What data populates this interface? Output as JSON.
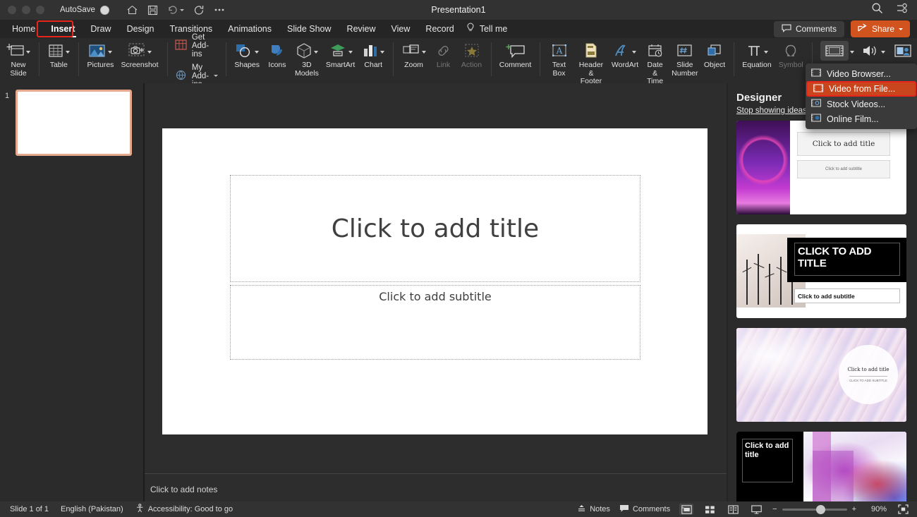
{
  "titlebar": {
    "autosave_label": "AutoSave",
    "document_title": "Presentation1",
    "qat": [
      {
        "name": "home-icon",
        "label": "Home"
      },
      {
        "name": "save-icon",
        "label": "Save"
      },
      {
        "name": "undo-icon",
        "label": "Undo"
      },
      {
        "name": "redo-icon",
        "label": "Redo"
      },
      {
        "name": "more-options-icon",
        "label": "More"
      }
    ],
    "search_icon": "search-icon",
    "ribbon_display_icon": "ribbon-display-options-icon"
  },
  "tabs": [
    {
      "label": "Home",
      "selected": false
    },
    {
      "label": "Insert",
      "selected": true
    },
    {
      "label": "Draw",
      "selected": false
    },
    {
      "label": "Design",
      "selected": false
    },
    {
      "label": "Transitions",
      "selected": false
    },
    {
      "label": "Animations",
      "selected": false
    },
    {
      "label": "Slide Show",
      "selected": false
    },
    {
      "label": "Review",
      "selected": false
    },
    {
      "label": "View",
      "selected": false
    },
    {
      "label": "Record",
      "selected": false
    }
  ],
  "tellme": {
    "label": "Tell me",
    "icon": "lightbulb-icon"
  },
  "header_actions": {
    "comments_label": "Comments",
    "share_label": "Share",
    "share_color": "#d1541f"
  },
  "highlight_color": "#e8251b",
  "ribbon": {
    "groups": [
      {
        "name": "slides",
        "buttons": [
          {
            "label": "New\nSlide",
            "icon": "new-slide-icon",
            "split": true,
            "dim": false
          }
        ]
      },
      {
        "name": "tables",
        "buttons": [
          {
            "label": "Table",
            "icon": "table-icon",
            "split": true,
            "dim": false
          }
        ]
      },
      {
        "name": "images",
        "buttons": [
          {
            "label": "Pictures",
            "icon": "pictures-icon",
            "split": true,
            "dim": false
          },
          {
            "label": "Screenshot",
            "icon": "screenshot-icon",
            "split": true,
            "dim": false
          }
        ]
      },
      {
        "name": "add-ins",
        "items": [
          {
            "label": "Get Add-ins",
            "icon": "get-addins-icon",
            "chevron": false
          },
          {
            "label": "My Add-ins",
            "icon": "my-addins-icon",
            "chevron": true
          }
        ]
      },
      {
        "name": "illustrations",
        "buttons": [
          {
            "label": "Shapes",
            "icon": "shapes-icon",
            "split": true,
            "dim": false
          },
          {
            "label": "Icons",
            "icon": "icons-icon",
            "split": false,
            "dim": false
          },
          {
            "label": "3D\nModels",
            "icon": "3d-models-icon",
            "split": true,
            "dim": false
          },
          {
            "label": "SmartArt",
            "icon": "smartart-icon",
            "split": true,
            "dim": false
          },
          {
            "label": "Chart",
            "icon": "chart-icon",
            "split": true,
            "dim": false
          }
        ]
      },
      {
        "name": "links",
        "buttons": [
          {
            "label": "Zoom",
            "icon": "zoom-icon",
            "split": true,
            "dim": false
          },
          {
            "label": "Link",
            "icon": "link-icon",
            "split": false,
            "dim": true
          },
          {
            "label": "Action",
            "icon": "action-icon",
            "split": false,
            "dim": true
          }
        ]
      },
      {
        "name": "comments",
        "buttons": [
          {
            "label": "Comment",
            "icon": "comment-icon",
            "split": false,
            "dim": false
          }
        ]
      },
      {
        "name": "text",
        "buttons": [
          {
            "label": "Text\nBox",
            "icon": "text-box-icon",
            "split": false,
            "dim": false
          },
          {
            "label": "Header &\nFooter",
            "icon": "header-footer-icon",
            "split": false,
            "dim": false
          },
          {
            "label": "WordArt",
            "icon": "wordart-icon",
            "split": true,
            "dim": false
          },
          {
            "label": "Date &\nTime",
            "icon": "date-time-icon",
            "split": false,
            "dim": false
          },
          {
            "label": "Slide\nNumber",
            "icon": "slide-number-icon",
            "split": false,
            "dim": false
          },
          {
            "label": "Object",
            "icon": "object-icon",
            "split": false,
            "dim": false
          }
        ]
      },
      {
        "name": "symbols",
        "buttons": [
          {
            "label": "Equation",
            "icon": "equation-icon",
            "split": true,
            "dim": false
          },
          {
            "label": "Symbol",
            "icon": "symbol-icon",
            "split": false,
            "dim": true
          }
        ]
      },
      {
        "name": "media",
        "buttons": [
          {
            "label": "",
            "icon": "video-icon",
            "split": true,
            "dim": false,
            "pressed": true
          },
          {
            "label": "",
            "icon": "audio-icon",
            "split": true,
            "dim": false
          },
          {
            "label": "",
            "icon": "cameo-icon",
            "split": false,
            "dim": false
          }
        ]
      }
    ]
  },
  "video_menu": {
    "items": [
      {
        "label": "Video Browser...",
        "icon": "video-browser-icon",
        "active": false
      },
      {
        "label": "Video from File...",
        "icon": "video-from-file-icon",
        "active": true
      },
      {
        "label": "Stock Videos...",
        "icon": "stock-videos-icon",
        "active": false
      },
      {
        "label": "Online Film...",
        "icon": "online-film-icon",
        "active": false
      }
    ]
  },
  "slide_panel": {
    "slide_number": "1",
    "selection_color": "#e6a98e"
  },
  "slide": {
    "title_placeholder": "Click to add title",
    "subtitle_placeholder": "Click to add subtitle"
  },
  "notes": {
    "placeholder": "Click to add notes"
  },
  "designer": {
    "title": "Designer",
    "stop_link": "Stop showing ideas",
    "ideas": [
      {
        "name": "neon-circle-idea",
        "title": "Click to add title",
        "subtitle": "Click to add subtitle"
      },
      {
        "name": "black-banner-idea",
        "title": "CLICK TO ADD TITLE",
        "subtitle": "Click to add subtitle"
      },
      {
        "name": "marble-circle-idea",
        "title": "Click to add title",
        "subtitle": "CLICK TO ADD SUBTITLE"
      },
      {
        "name": "color-blocks-idea",
        "title": "Click to add title",
        "subtitle": ""
      }
    ]
  },
  "statusbar": {
    "slide_count": "Slide 1 of 1",
    "language": "English (Pakistan)",
    "accessibility": "Accessibility: Good to go",
    "notes_label": "Notes",
    "comments_label": "Comments",
    "views": [
      {
        "name": "normal-view-button",
        "active": true
      },
      {
        "name": "slide-sorter-view-button",
        "active": false
      },
      {
        "name": "reading-view-button",
        "active": false
      },
      {
        "name": "slide-show-button",
        "active": false
      }
    ],
    "zoom_out": "−",
    "zoom_in": "+",
    "zoom_level": "90%",
    "fit_slide_icon": "fit-to-window-icon"
  }
}
